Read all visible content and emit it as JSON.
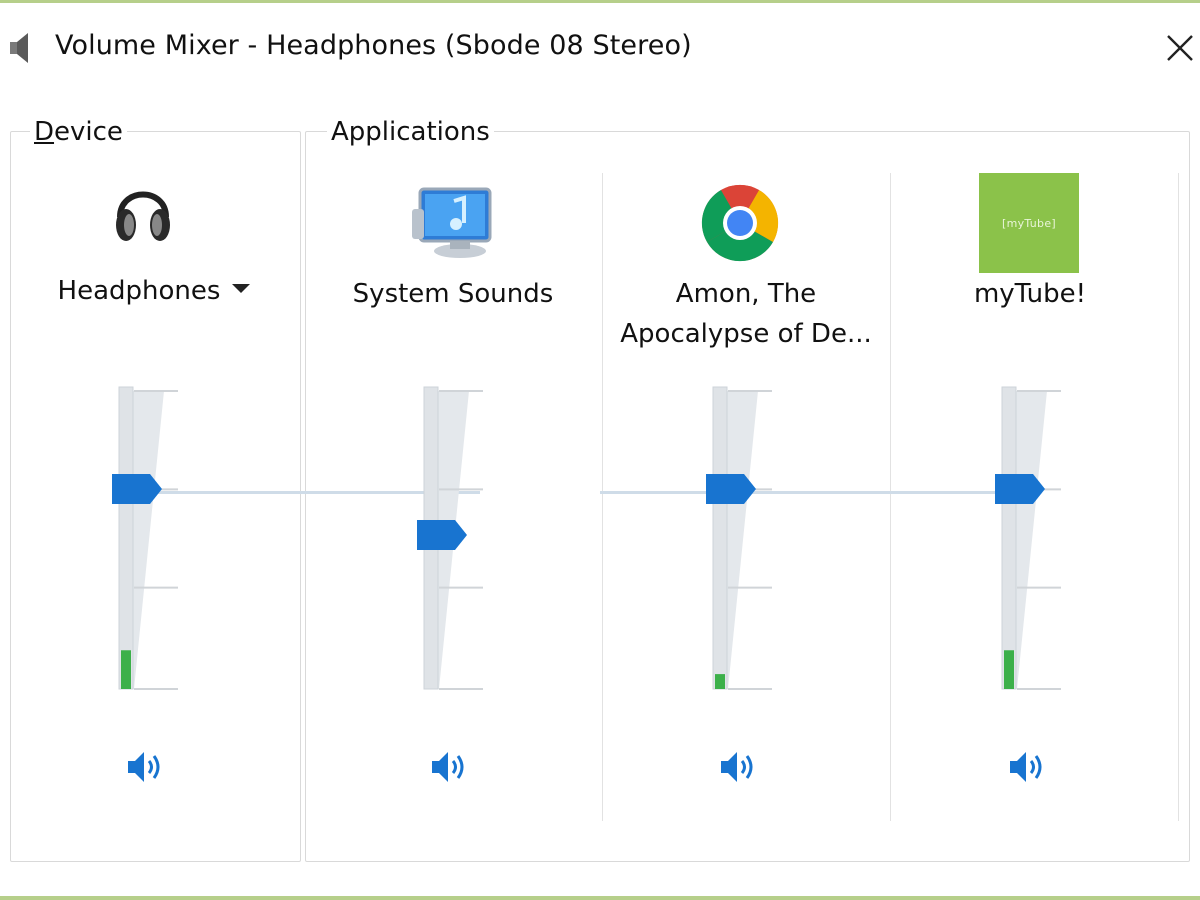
{
  "window": {
    "title": "Volume Mixer - Headphones (Sbode 08 Stereo)",
    "title_icon": "speaker-icon",
    "close_icon": "close-icon",
    "frame_color": "#b6cf8a"
  },
  "device_group": {
    "label_access_key": "D",
    "label_rest": "evice",
    "channel": {
      "name": "Headphones",
      "icon": "headphones-icon",
      "has_dropdown": true,
      "volume_percent": 100,
      "peak_level_percent": 13,
      "mute_icon": "speaker-volume-icon"
    }
  },
  "applications_group": {
    "label": "Applications",
    "channels": [
      {
        "name": "System Sounds",
        "icon": "system-sounds-icon",
        "volume_percent": 83,
        "peak_level_percent": 0,
        "mute_icon": "speaker-volume-icon"
      },
      {
        "name_line1": "Amon, The",
        "name_line2": "Apocalypse of De...",
        "icon": "chrome-icon",
        "volume_percent": 100,
        "peak_level_percent": 5,
        "mute_icon": "speaker-volume-icon"
      },
      {
        "name": "myTube!",
        "icon": "mytube-icon",
        "icon_text": "[myTube]",
        "volume_percent": 100,
        "peak_level_percent": 13,
        "mute_icon": "speaker-volume-icon"
      }
    ]
  },
  "colors": {
    "accent": "#1874d0",
    "meter": "#3cb04a",
    "mytube_bg": "#8bc24a"
  }
}
